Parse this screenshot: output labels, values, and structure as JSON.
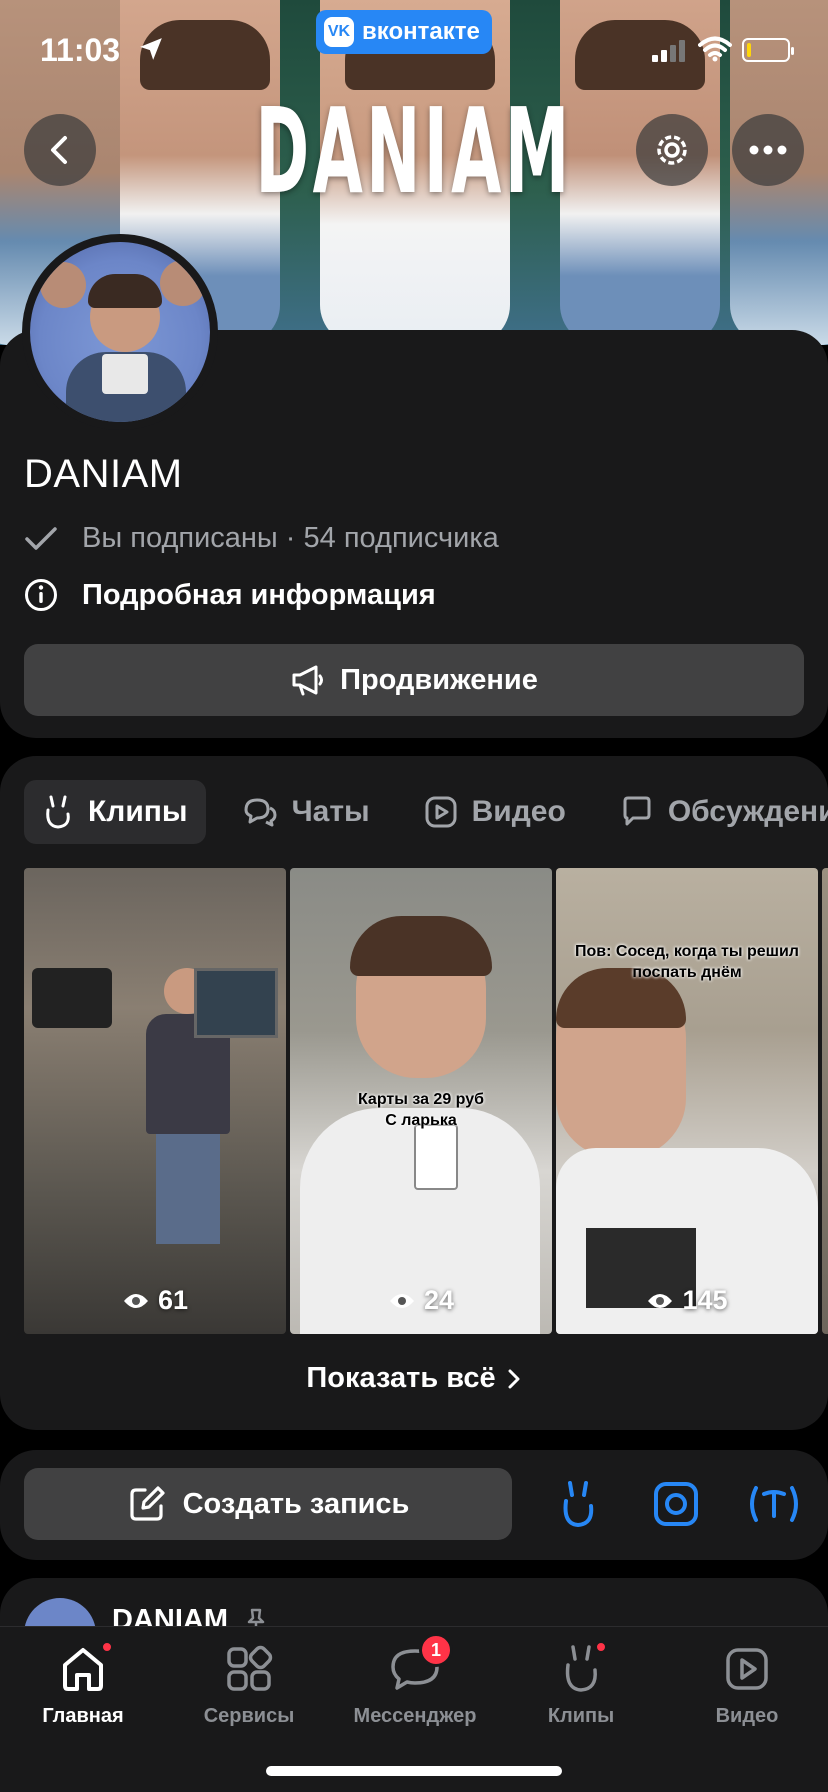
{
  "status": {
    "time": "11:03"
  },
  "vk_pill": {
    "label": "вконтакте",
    "logo_text": "VK"
  },
  "cover": {
    "title": "DANIAM"
  },
  "profile": {
    "name": "DANIAM",
    "subscribed_line": "Вы подписаны · 54 подписчика",
    "details_label": "Подробная информация",
    "promo_label": "Продвижение"
  },
  "clips_section": {
    "tabs": [
      {
        "label": "Клипы",
        "icon": "clips-icon",
        "active": true
      },
      {
        "label": "Чаты",
        "icon": "chats-icon",
        "active": false
      },
      {
        "label": "Видео",
        "icon": "video-icon",
        "active": false
      },
      {
        "label": "Обсуждения",
        "icon": "discussion-icon",
        "active": false
      }
    ],
    "clips": [
      {
        "views": "61",
        "caption": ""
      },
      {
        "views": "24",
        "caption": "Карты за 29 руб\nС ларька"
      },
      {
        "views": "145",
        "caption": "Пов: Сосед, когда ты решил\nпоспать днём"
      }
    ],
    "show_all_label": "Показать всё"
  },
  "create": {
    "label": "Создать запись"
  },
  "post": {
    "author": "DANIAM"
  },
  "tabbar": {
    "items": [
      {
        "label": "Главная",
        "icon": "home-icon"
      },
      {
        "label": "Сервисы",
        "icon": "services-icon"
      },
      {
        "label": "Мессенджер",
        "icon": "messenger-icon",
        "badge": "1"
      },
      {
        "label": "Клипы",
        "icon": "clips-icon"
      },
      {
        "label": "Видео",
        "icon": "video-icon"
      }
    ]
  },
  "colors": {
    "accent": "#2787f5",
    "card": "#19191a",
    "button": "#414142",
    "badge": "#ff3347",
    "muted": "#a2a5aa"
  }
}
